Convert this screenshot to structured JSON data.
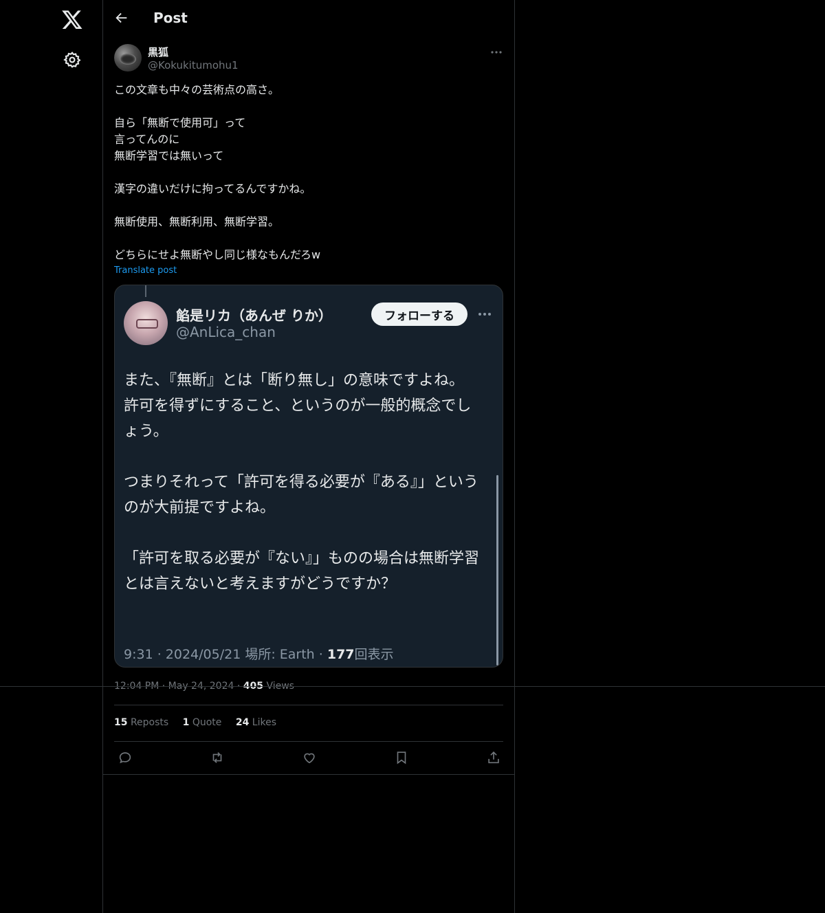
{
  "sidebar": {
    "logo_icon": "x-logo-icon",
    "settings_icon": "gear-icon"
  },
  "header": {
    "title": "Post",
    "back_icon": "back-arrow-icon"
  },
  "post": {
    "display_name": "黒狐",
    "handle": "@Kokukitumohu1",
    "text_paragraphs": [
      "この文章も中々の芸術点の高さ。",
      "自ら「無断で使用可」って\n言ってんのに\n無断学習では無いって",
      "漢字の違いだけに拘ってるんですかね。",
      "無断使用、無断利用、無断学習。",
      "どちらにせよ無断やし同じ様なもんだろw"
    ],
    "translate_label": "Translate post",
    "timestamp": "12:04 PM · May 24, 2024 · ",
    "views_count": "405",
    "views_label": " Views",
    "stats": {
      "reposts_count": "15",
      "reposts_label": "Reposts",
      "quotes_count": "1",
      "quotes_label": "Quote",
      "likes_count": "24",
      "likes_label": "Likes"
    }
  },
  "embedded_screenshot": {
    "display_name": "餡是リカ（あんぜ りか）",
    "handle": "@AnLica_chan",
    "follow_label": "フォローする",
    "text_paragraphs": [
      "また、『無断』とは「断り無し」の意味ですよね。\n許可を得ずにすること、というのが一般的概念でしょう。",
      "つまりそれって「許可を得る必要が『ある』」というのが大前提ですよね。",
      "「許可を取る必要が『ない』」ものの場合は無断学習とは言えないと考えますがどうですか？"
    ],
    "meta_prefix": "9:31 · 2024/05/21 場所: Earth · ",
    "views_count": "177",
    "views_label": "回表示"
  },
  "colors": {
    "background": "#000000",
    "text": "#e7e9ea",
    "muted": "#71767b",
    "link": "#1d9bf0",
    "border": "#2f3336",
    "card_bg": "#15202b"
  }
}
